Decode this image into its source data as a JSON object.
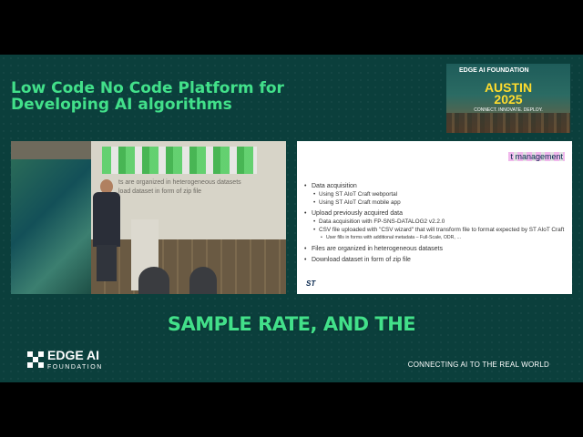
{
  "header": {
    "title_line1": "Low Code No Code Platform for",
    "title_line2": "Developing AI algorithms"
  },
  "event_badge": {
    "org": "EDGE AI FOUNDATION",
    "city": "AUSTIN",
    "year": "2025",
    "tagline": "CONNECT. INNOVATE. DEPLOY."
  },
  "video_overlay": {
    "ghost_text_1": "ts are organized in heterogeneous datasets",
    "ghost_text_2": "load dataset in form of zip file"
  },
  "slide": {
    "title": "t management",
    "bullets": [
      {
        "level": 1,
        "text": "Data acquisition"
      },
      {
        "level": 2,
        "text": "Using ST AIoT Craft webportal"
      },
      {
        "level": 2,
        "text": "Using ST AIoT Craft mobile app"
      },
      {
        "level": 1,
        "text": "Upload previously acquired data"
      },
      {
        "level": 2,
        "text": "Data acquisition with FP-SNS-DATALOG2 v2.2.0"
      },
      {
        "level": 2,
        "text": "CSV file uploaded with \"CSV wizard\" that will transform file to format expected by ST AIoT Craft"
      },
      {
        "level": 3,
        "text": "User fills in forms with additional metadata – Full-Scale, ODR, …"
      },
      {
        "level": 1,
        "text": "Files are organized in heterogeneous datasets"
      },
      {
        "level": 1,
        "text": "Download dataset in form of zip file"
      }
    ],
    "logo": "ST"
  },
  "caption": "SAMPLE RATE, AND THE",
  "footer": {
    "brand": "EDGE AI",
    "foundation": "FOUNDATION",
    "tagline": "CONNECTING AI TO THE REAL WORLD"
  },
  "colors": {
    "background": "#0b3f3c",
    "accent_green": "#42e08a",
    "letterbox": "#000000"
  }
}
